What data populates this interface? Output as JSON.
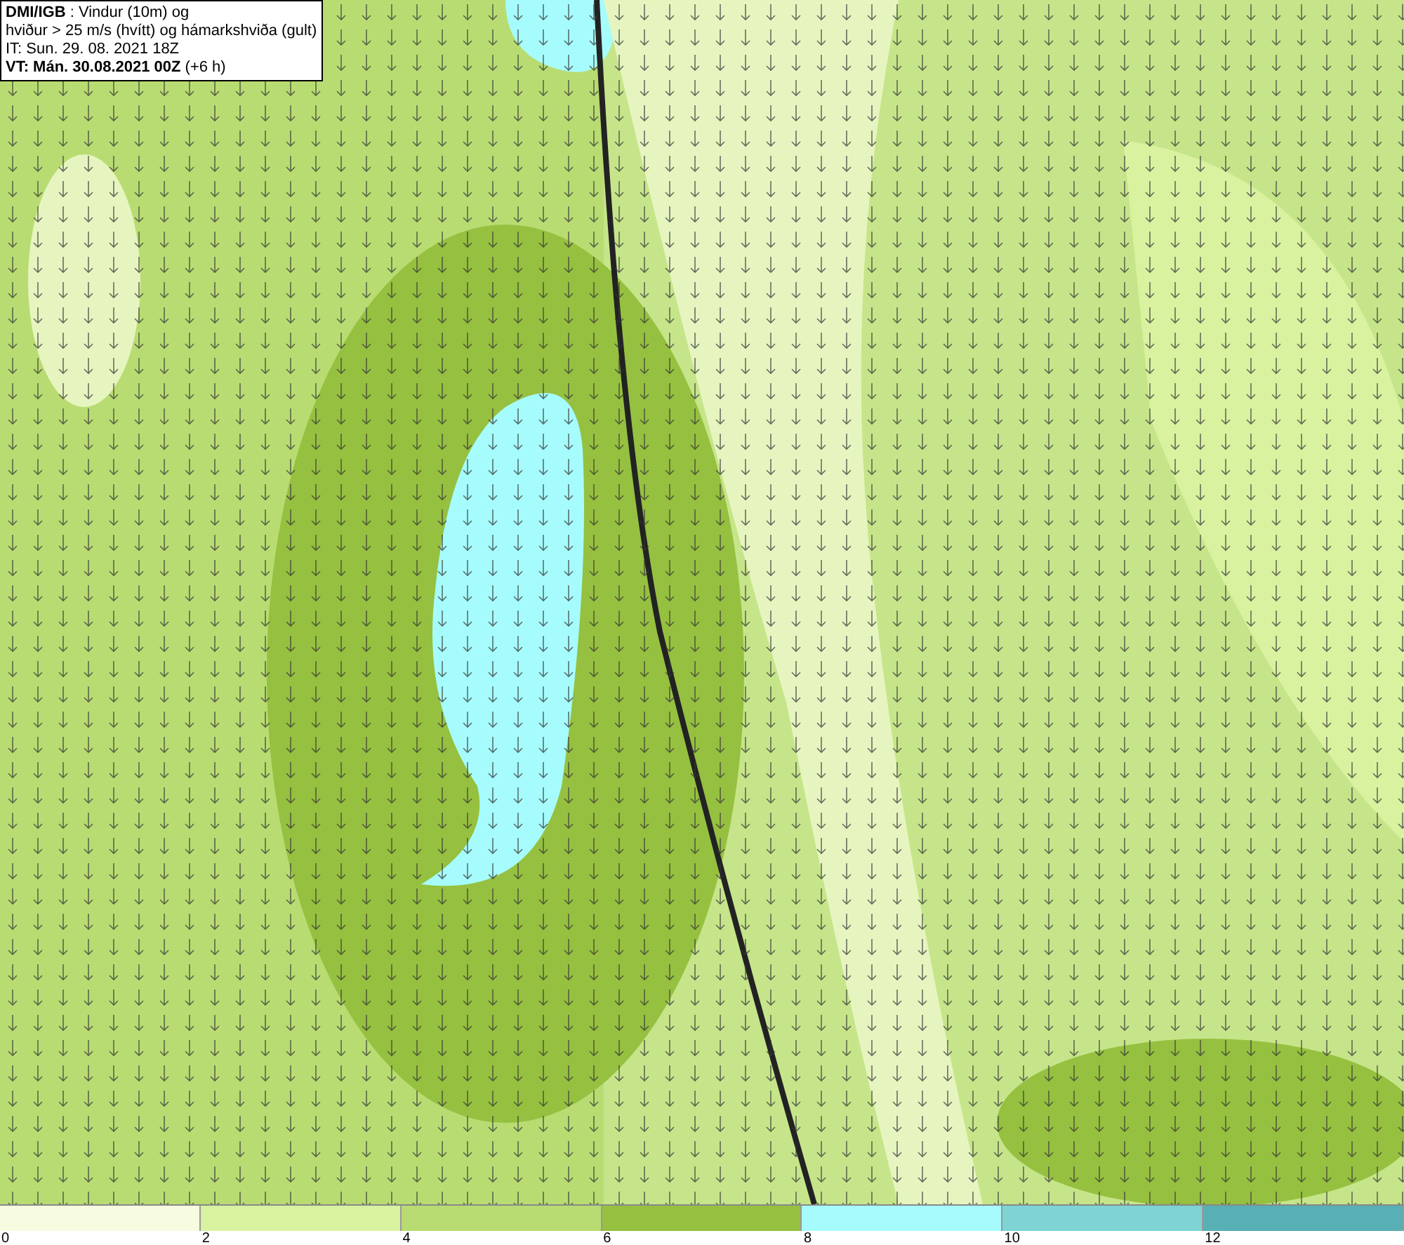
{
  "title_box": {
    "lines": [
      "**DMI/IGB** : Vindur (10m) og",
      "hviður > 25 m/s (hvítt) og hámarkshviða (gult)",
      "IT: Sun. 29. 08. 2021 18Z",
      "**VT: Mán. 30.08.2021 00Z** (+6 h)"
    ]
  },
  "legend": {
    "bins": [
      {
        "color": "#f7fbe0"
      },
      {
        "color": "#d8f2a0"
      },
      {
        "color": "#b8dc72"
      },
      {
        "color": "#96c040"
      },
      {
        "color": "#a6fcfc"
      },
      {
        "color": "#7ed4d4"
      },
      {
        "color": "#58b0b4"
      }
    ],
    "ticks": [
      "0",
      "2",
      "4",
      "6",
      "8",
      "10",
      "12"
    ]
  }
}
